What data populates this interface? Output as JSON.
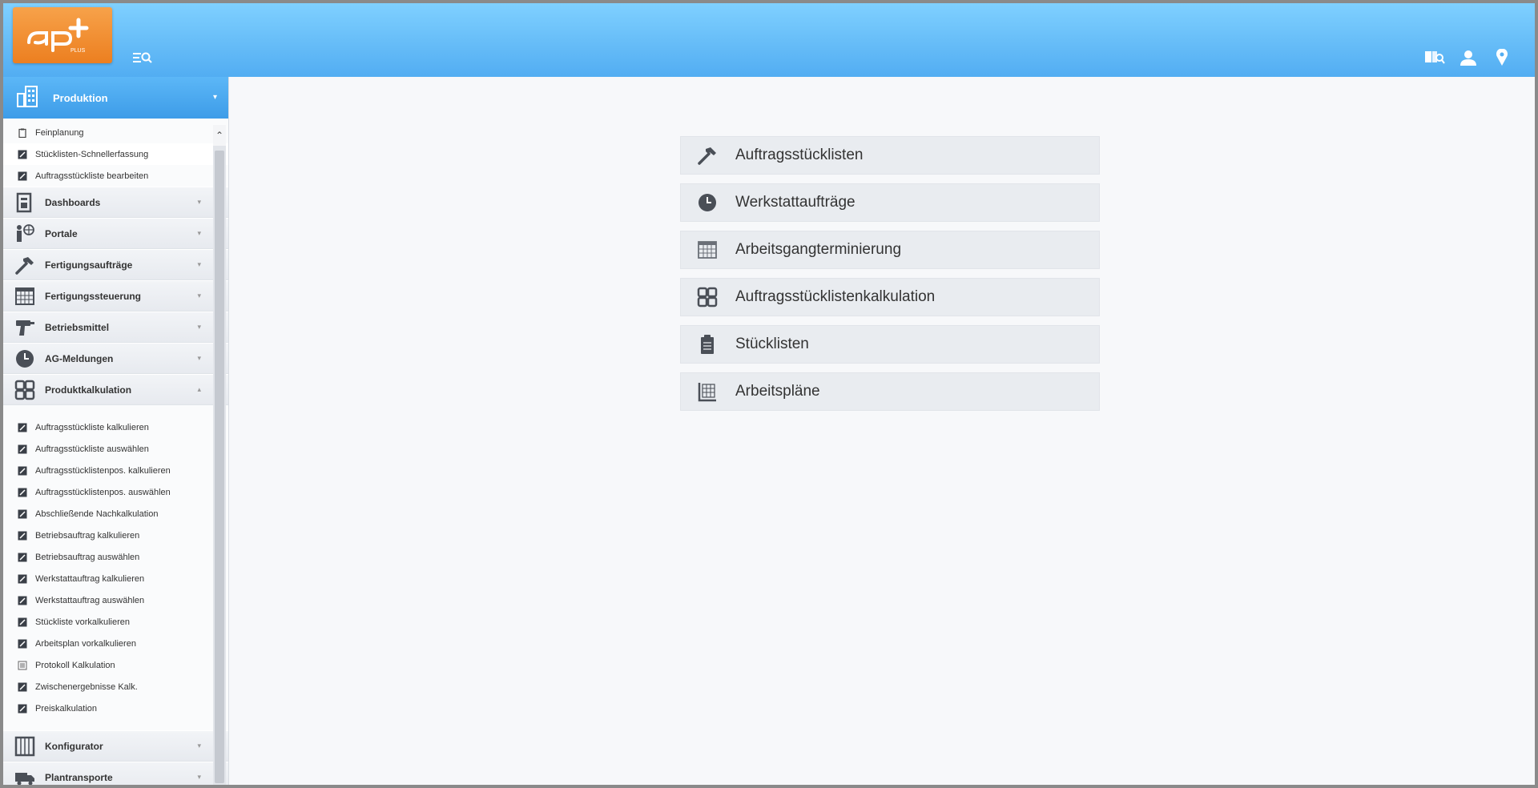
{
  "header": {
    "logo_text": "ap+ PLUS",
    "icons": [
      "search-menu-icon",
      "book-search-icon",
      "user-icon",
      "location-pin-icon"
    ]
  },
  "sidebar": {
    "main": {
      "label": "Produktion",
      "icon": "building-icon",
      "expanded": true
    },
    "produktion_items": [
      {
        "label": "Feinplanung",
        "icon": "clipboard-icon"
      },
      {
        "label": "Stücklisten-Schnellerfassung",
        "icon": "edit-icon"
      },
      {
        "label": "Auftragsstückliste bearbeiten",
        "icon": "edit-icon"
      }
    ],
    "categories": [
      {
        "label": "Dashboards",
        "icon": "dashboard-icon"
      },
      {
        "label": "Portale",
        "icon": "portal-icon"
      },
      {
        "label": "Fertigungsaufträge",
        "icon": "hammer-icon"
      },
      {
        "label": "Fertigungssteuerung",
        "icon": "calendar-icon"
      },
      {
        "label": "Betriebsmittel",
        "icon": "drill-icon"
      },
      {
        "label": "AG-Meldungen",
        "icon": "clock-icon"
      },
      {
        "label": "Produktkalkulation",
        "icon": "grid-icon",
        "expanded": true
      }
    ],
    "kalkulation_items": [
      {
        "label": "Auftragsstückliste kalkulieren",
        "icon": "edit-icon"
      },
      {
        "label": "Auftragsstückliste auswählen",
        "icon": "edit-icon"
      },
      {
        "label": "Auftragsstücklistenpos. kalkulieren",
        "icon": "edit-icon"
      },
      {
        "label": "Auftragsstücklistenpos. auswählen",
        "icon": "edit-icon"
      },
      {
        "label": "Abschließende Nachkalkulation",
        "icon": "edit-icon"
      },
      {
        "label": "Betriebsauftrag kalkulieren",
        "icon": "edit-icon"
      },
      {
        "label": "Betriebsauftrag auswählen",
        "icon": "edit-icon"
      },
      {
        "label": "Werkstattauftrag kalkulieren",
        "icon": "edit-icon"
      },
      {
        "label": "Werkstattauftrag auswählen",
        "icon": "edit-icon"
      },
      {
        "label": "Stückliste vorkalkulieren",
        "icon": "edit-icon"
      },
      {
        "label": "Arbeitsplan vorkalkulieren",
        "icon": "edit-icon"
      },
      {
        "label": "Protokoll Kalkulation",
        "icon": "list-icon"
      },
      {
        "label": "Zwischenergebnisse Kalk.",
        "icon": "edit-icon"
      },
      {
        "label": "Preiskalkulation",
        "icon": "edit-icon"
      }
    ],
    "bottom_categories": [
      {
        "label": "Konfigurator",
        "icon": "configurator-icon"
      },
      {
        "label": "Plantransporte",
        "icon": "truck-icon"
      }
    ]
  },
  "tiles": [
    {
      "label": "Auftragsstücklisten",
      "icon": "hammer-icon"
    },
    {
      "label": "Werkstattaufträge",
      "icon": "clock-icon"
    },
    {
      "label": "Arbeitsgangterminierung",
      "icon": "calendar-icon"
    },
    {
      "label": "Auftragsstücklistenkalkulation",
      "icon": "grid-icon"
    },
    {
      "label": "Stücklisten",
      "icon": "clipboard-icon"
    },
    {
      "label": "Arbeitspläne",
      "icon": "workplan-icon"
    }
  ],
  "colors": {
    "header_top": "#7fd0ff",
    "header_bottom": "#52adf2",
    "logo": "#ec7f20",
    "sidebar_active": "#3d9ce8",
    "tile_bg": "#e9ecf0",
    "icon_dark": "#4a4f57"
  }
}
